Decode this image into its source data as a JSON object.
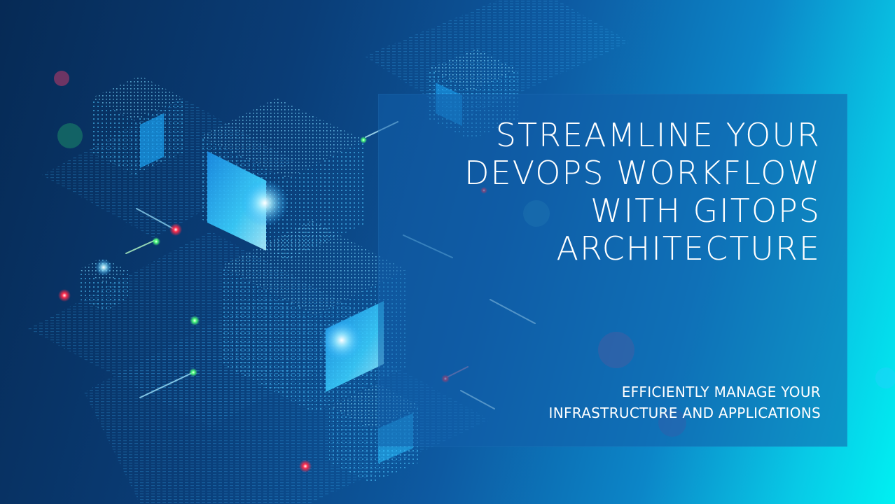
{
  "hero": {
    "headline_lines": [
      "STREAMLINE YOUR",
      "DEVOPS WORKFLOW",
      "WITH GITOPS",
      "ARCHITECTURE"
    ],
    "subhead_lines": [
      "EFFICIENTLY MANAGE YOUR",
      "INFRASTRUCTURE AND APPLICATIONS"
    ]
  },
  "colors": {
    "background_dark": "#062a55",
    "background_light": "#00f0f2",
    "panel": "#125faa",
    "text": "#ffffff",
    "glow_cyan": "#5fe2ff",
    "light_red": "#ff2a4a",
    "light_green": "#4cff7a"
  }
}
